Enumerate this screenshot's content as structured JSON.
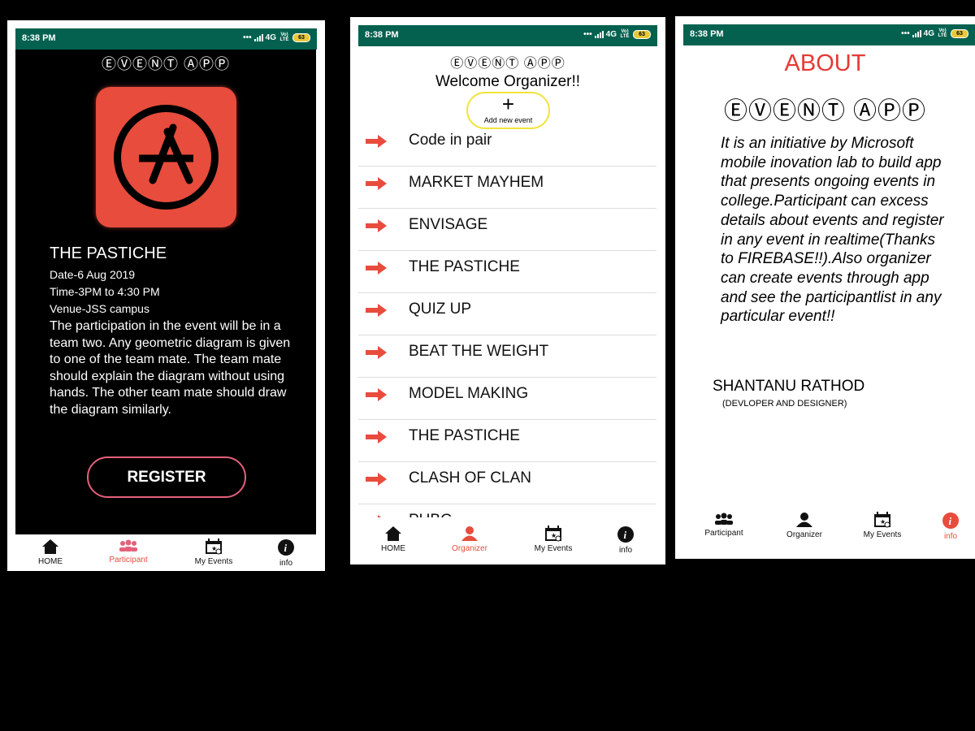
{
  "status": {
    "time": "8:38 PM",
    "network": "4G",
    "volte": "Vo) LTE",
    "battery": "63"
  },
  "app_title": "ⒺⓋⒺⓃⓉ ⒶⓅⓅ",
  "participant_screen": {
    "event_name": "THE PASTICHE",
    "date": "Date-6 Aug 2019",
    "time": "Time-3PM to 4:30 PM",
    "venue": "Venue-JSS campus",
    "description": "The participation in the event will be in a team two. Any geometric diagram is given to one of the team mate. The team mate should explain the diagram without using hands. The other team mate should draw the diagram similarly.",
    "register_label": "REGISTER",
    "nav": [
      {
        "label": "HOME",
        "icon": "home-icon"
      },
      {
        "label": "Participant",
        "icon": "participant-icon"
      },
      {
        "label": "My Events",
        "icon": "calendar-icon"
      },
      {
        "label": "info",
        "icon": "info-icon"
      }
    ]
  },
  "organizer_screen": {
    "welcome": "Welcome Organizer!!",
    "add_label": "Add new event",
    "events": [
      "Code in pair",
      "MARKET MAYHEM",
      "ENVISAGE",
      "THE PASTICHE",
      "QUIZ UP",
      "BEAT THE WEIGHT",
      "MODEL MAKING",
      "THE PASTICHE",
      "CLASH OF CLAN",
      "PUBG"
    ],
    "nav": [
      {
        "label": "HOME",
        "icon": "home-icon"
      },
      {
        "label": "Organizer",
        "icon": "organizer-icon"
      },
      {
        "label": "My Events",
        "icon": "calendar-icon"
      },
      {
        "label": "info",
        "icon": "info-icon"
      }
    ]
  },
  "about_screen": {
    "heading": "ABOUT",
    "description": "It is an initiative by Microsoft mobile inovation lab to build app that presents ongoing events in college.Participant can excess details about events and register in any event in realtime(Thanks to FIREBASE!!).Also organizer can create events through app and see the participantlist in any particular event!!",
    "author": "SHANTANU RATHOD",
    "role": "(DEVLOPER AND DESIGNER)",
    "nav": [
      {
        "label": "Participant",
        "icon": "participant-icon"
      },
      {
        "label": "Organizer",
        "icon": "organizer-icon"
      },
      {
        "label": "My Events",
        "icon": "calendar-icon"
      },
      {
        "label": "info",
        "icon": "info-icon"
      }
    ]
  },
  "colors": {
    "statusbar": "#05614f",
    "accent": "#e74c3c",
    "highlight": "#f2e43a",
    "register_border": "#e4607a"
  }
}
